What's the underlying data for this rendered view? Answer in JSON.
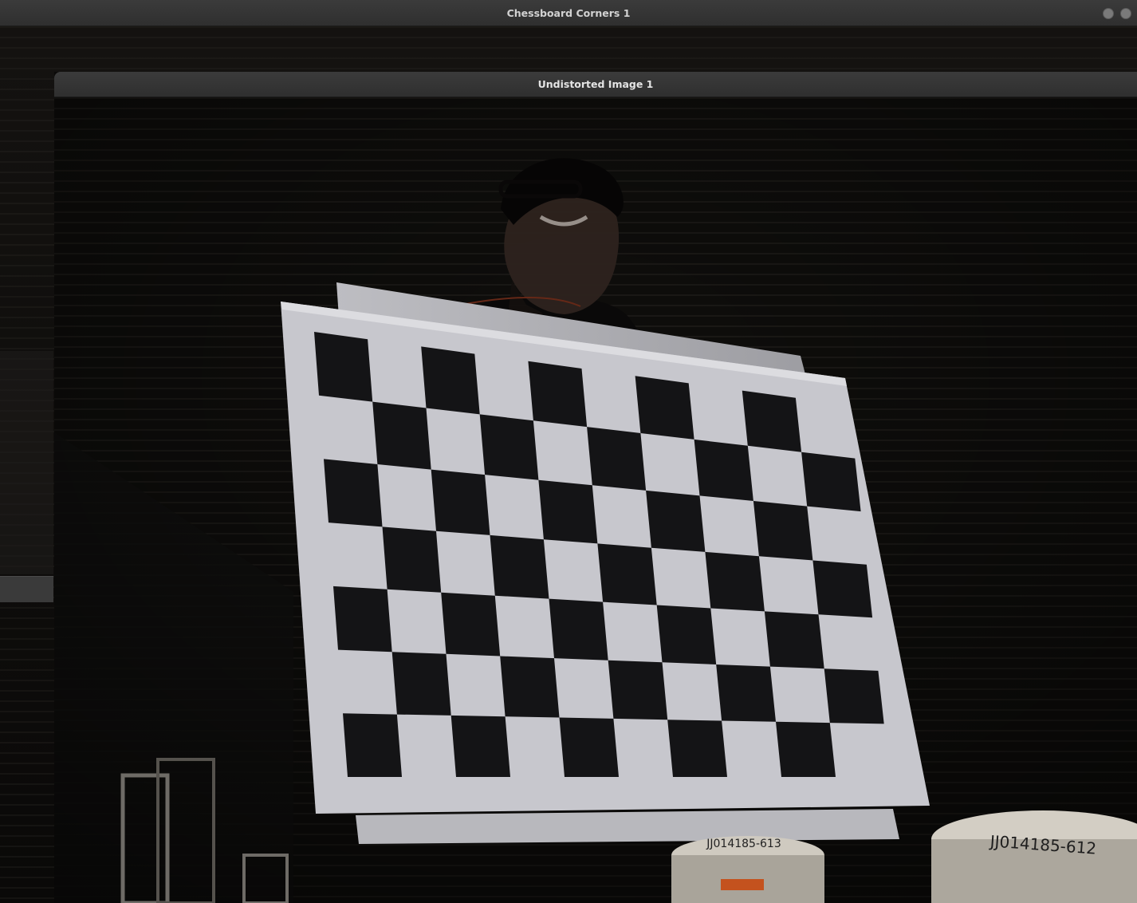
{
  "windows": {
    "back": {
      "title": "Chessboard Corners 1"
    },
    "front": {
      "title": "Undistorted Image 1"
    }
  },
  "scene": {
    "stamp_right": "JJ014185-612",
    "stamp_left": "JJ014185-613"
  },
  "colors": {
    "titlebar": "#353535",
    "title_text": "#e4e4e4",
    "board_white": "#c9c9cf",
    "board_black": "#141416",
    "background": "#0c0b0a"
  }
}
